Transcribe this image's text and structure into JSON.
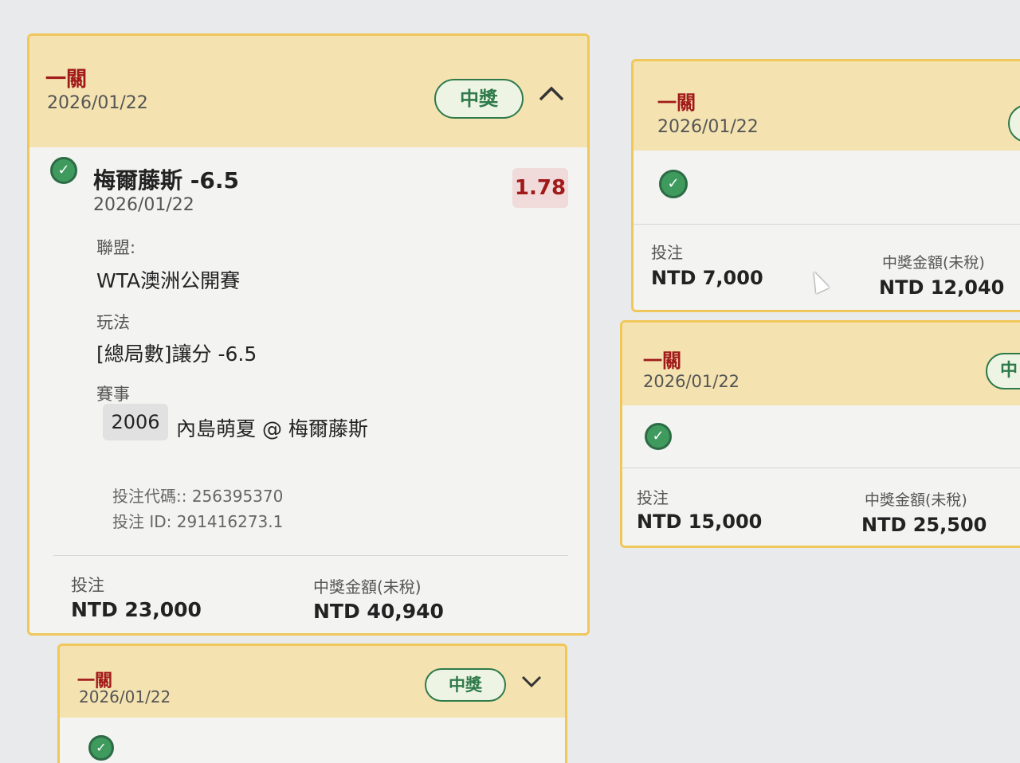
{
  "colors": {
    "accent_border": "#f0c75a",
    "header_bg": "#f4e3b1",
    "win_green": "#2f7a4a",
    "odds_red": "#a11a1a"
  },
  "main_card": {
    "type_label": "一關",
    "date": "2026/01/22",
    "status_pill": "中獎",
    "toggle_icon": "chevron-up-icon",
    "selection": {
      "name": "梅爾藤斯 -6.5",
      "date": "2026/01/22",
      "odds": "1.78",
      "league_label": "聯盟:",
      "league_value": "WTA澳洲公開賽",
      "market_label": "玩法",
      "market_value": "[總局數]讓分 -6.5",
      "event_label": "賽事",
      "event_code": "2006",
      "event_match": "內島萌夏 @ 梅爾藤斯",
      "bet_code": "投注代碼:: 256395370",
      "bet_id": "投注 ID: 291416273.1"
    },
    "stake_label": "投注",
    "stake_value": "NTD 23,000",
    "payout_label": "中獎金額(未稅)",
    "payout_value": "NTD 40,940"
  },
  "bottom_card": {
    "type_label": "一關",
    "date": "2026/01/22",
    "status_pill": "中獎",
    "toggle_icon": "chevron-down-icon"
  },
  "right_card_1": {
    "type_label": "一關",
    "date": "2026/01/22",
    "stake_label": "投注",
    "stake_value": "NTD 7,000",
    "payout_label": "中獎金額(未稅)",
    "payout_value": "NTD 12,040"
  },
  "right_card_2": {
    "type_label": "一關",
    "date": "2026/01/22",
    "status_pill": "中",
    "stake_label": "投注",
    "stake_value": "NTD 15,000",
    "payout_label": "中獎金額(未稅)",
    "payout_value": "NTD 25,500"
  }
}
